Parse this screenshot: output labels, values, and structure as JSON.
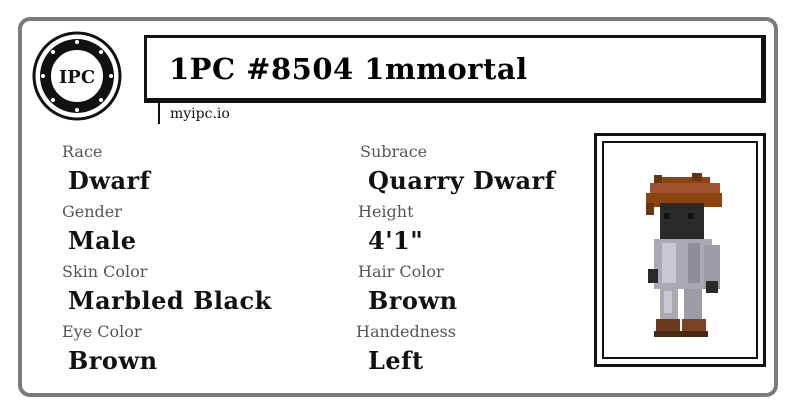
{
  "card": {
    "title": "1PC #8504 1mmortal",
    "site": "myipc.io",
    "logo_text": "IPC"
  },
  "attributes": {
    "race": {
      "label": "Race",
      "value": "Dwarf"
    },
    "subrace": {
      "label": "Subrace",
      "value": "Quarry Dwarf"
    },
    "gender": {
      "label": "Gender",
      "value": "Male"
    },
    "height": {
      "label": "Height",
      "value": "4'1\""
    },
    "skin_color": {
      "label": "Skin Color",
      "value": "Marbled Black"
    },
    "hair_color": {
      "label": "Hair Color",
      "value": "Brown"
    },
    "eye_color": {
      "label": "Eye Color",
      "value": "Brown"
    },
    "handedness": {
      "label": "Handedness",
      "value": "Left"
    }
  },
  "colors": {
    "border": "#7a7a7a",
    "ink": "#111111",
    "label": "#555555",
    "hair": "#8b4513",
    "skin": "#2a2a2a",
    "armor": "#a9a9b3",
    "boots": "#6b3a1e"
  },
  "icons": {
    "logo": "ipc-seal-icon",
    "portrait": "dwarf-character-sprite"
  }
}
